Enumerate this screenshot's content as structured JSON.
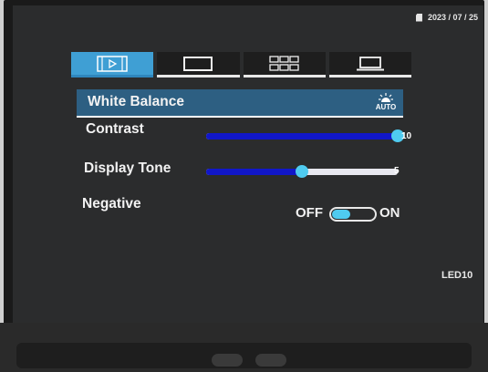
{
  "status": {
    "date": "2023 / 07 / 25"
  },
  "tabs": [
    {
      "icon": "movie-settings-icon",
      "active": true
    },
    {
      "icon": "screen-display-icon",
      "active": false
    },
    {
      "icon": "grid-layout-icon",
      "active": false
    },
    {
      "icon": "laptop-icon",
      "active": false
    }
  ],
  "menu": {
    "white_balance": {
      "label": "White Balance",
      "icon": "auto-white-balance-icon",
      "icon_text": "AUTO"
    },
    "contrast": {
      "label": "Contrast",
      "value": "10",
      "level": 10,
      "max": 10
    },
    "display_tone": {
      "label": "Display Tone",
      "value": "5",
      "level": 5,
      "max": 10
    },
    "negative": {
      "label": "Negative",
      "off_label": "OFF",
      "on_label": "ON",
      "state": "off"
    }
  },
  "model": "LED10",
  "colors": {
    "accent": "#3f9fd4",
    "selected_row": "#2d5f82",
    "slider_fill": "#1117c9",
    "thumb": "#4fcbf0",
    "background": "#2b2c2d"
  }
}
